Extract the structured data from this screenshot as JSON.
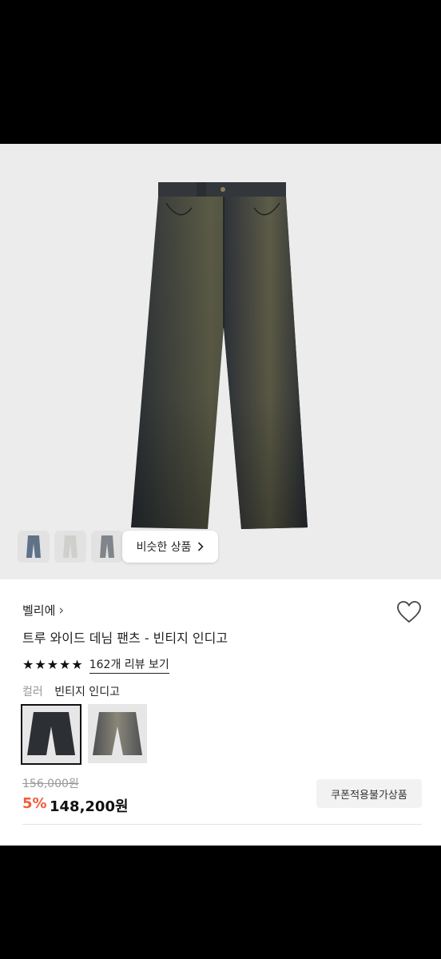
{
  "hero": {
    "similar_button_label": "비슷한 상품",
    "thumbnails": [
      "thumb-dark-denim",
      "thumb-light-denim",
      "thumb-grey-denim"
    ]
  },
  "product": {
    "brand": "벨리에",
    "brand_chevron": "›",
    "title": "트루 와이드 데님 팬츠 - 빈티지 인디고",
    "stars": 5,
    "review_link": "162개 리뷰 보기",
    "color_label": "컬러",
    "color_value": "빈티지 인디고",
    "original_price": "156,000원",
    "discount": "5%",
    "price": "148,200원",
    "coupon_badge": "쿠폰적용불가상품"
  },
  "colors": {
    "accent": "#f25c3a",
    "denim_dark": "#2b3036",
    "denim_wash": "#6d6a4c"
  }
}
